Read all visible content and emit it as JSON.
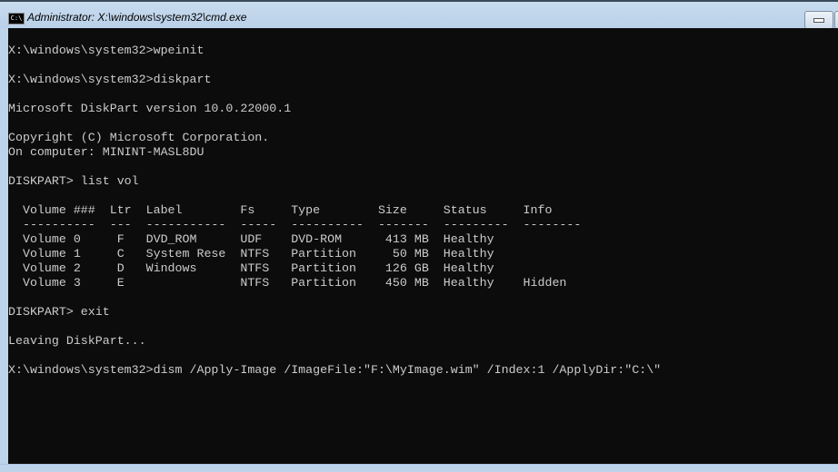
{
  "window": {
    "title": "Administrator: X:\\windows\\system32\\cmd.exe",
    "icon": "cmd-icon",
    "icon_text": "C:\\"
  },
  "console": {
    "lines": [
      "X:\\windows\\system32>wpeinit",
      "",
      "X:\\windows\\system32>diskpart",
      "",
      "Microsoft DiskPart version 10.0.22000.1",
      "",
      "Copyright (C) Microsoft Corporation.",
      "On computer: MININT-MASL8DU",
      "",
      "DISKPART> list vol",
      "",
      "  Volume ###  Ltr  Label        Fs     Type        Size     Status     Info",
      "  ----------  ---  -----------  -----  ----------  -------  ---------  --------",
      "  Volume 0     F   DVD_ROM      UDF    DVD-ROM      413 MB  Healthy",
      "  Volume 1     C   System Rese  NTFS   Partition     50 MB  Healthy",
      "  Volume 2     D   Windows      NTFS   Partition    126 GB  Healthy",
      "  Volume 3     E                NTFS   Partition    450 MB  Healthy    Hidden",
      "",
      "DISKPART> exit",
      "",
      "Leaving DiskPart...",
      "",
      "X:\\windows\\system32>dism /Apply-Image /ImageFile:\"F:\\MyImage.wim\" /Index:1 /ApplyDir:\"C:\\\""
    ]
  }
}
